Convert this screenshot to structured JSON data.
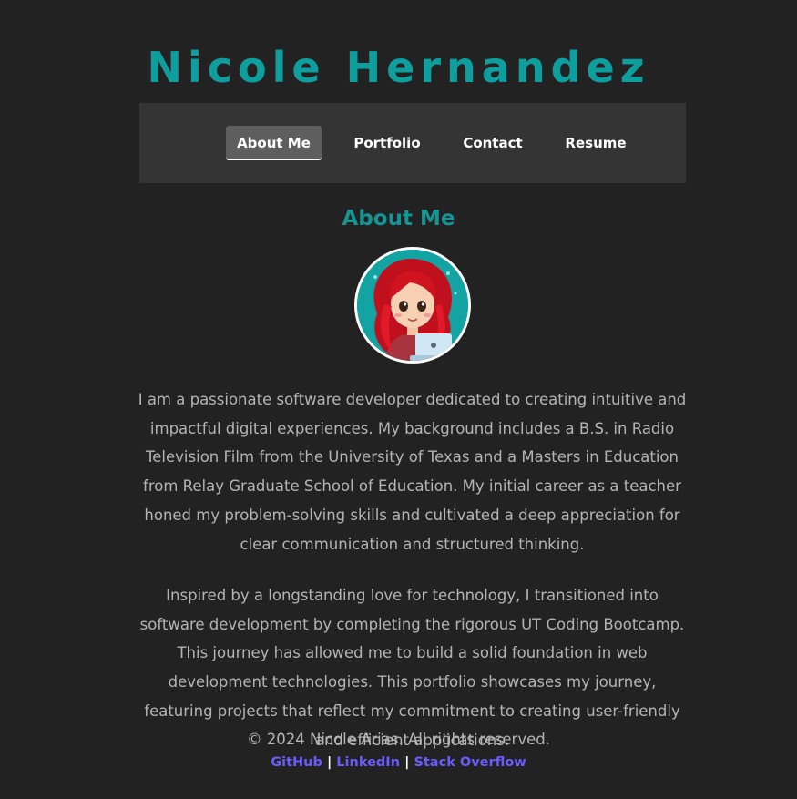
{
  "header": {
    "title": "Nicole Hernandez"
  },
  "nav": {
    "items": [
      {
        "label": "About Me",
        "active": true
      },
      {
        "label": "Portfolio",
        "active": false
      },
      {
        "label": "Contact",
        "active": false
      },
      {
        "label": "Resume",
        "active": false
      }
    ]
  },
  "about": {
    "heading": "About Me",
    "paragraph_1": "I am a passionate software developer dedicated to creating intuitive and impactful digital experiences. My background includes a B.S. in Radio Television Film from the University of Texas and a Masters in Education from Relay Graduate School of Education. My initial career as a teacher honed my problem-solving skills and cultivated a deep appreciation for clear communication and structured thinking.",
    "paragraph_2": "Inspired by a longstanding love for technology, I transitioned into software development by completing the rigorous UT Coding Bootcamp. This journey has allowed me to build a solid foundation in web development technologies. This portfolio showcases my journey, featuring projects that reflect my commitment to creating user-friendly and efficient applications."
  },
  "footer": {
    "copyright": "© 2024 Nicole Arias. All rights reserved.",
    "links": [
      "GitHub",
      "LinkedIn",
      "Stack Overflow"
    ],
    "separator": "|"
  },
  "colors": {
    "background": "#222222",
    "accent": "#0e9e9e",
    "nav_background": "#343434",
    "link": "#6a5cff"
  }
}
